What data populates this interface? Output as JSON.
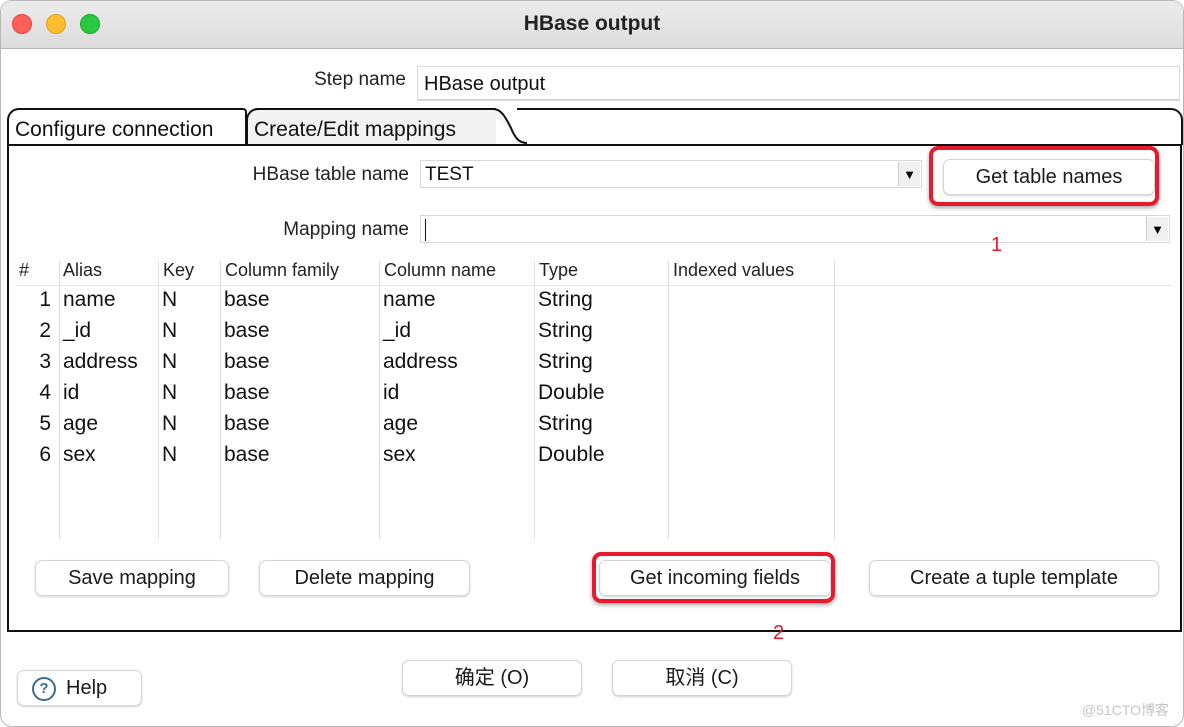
{
  "window": {
    "title": "HBase output"
  },
  "step": {
    "label": "Step name",
    "value": "HBase output"
  },
  "tabs": [
    {
      "label": "Configure connection",
      "active": false
    },
    {
      "label": "Create/Edit mappings",
      "active": true
    }
  ],
  "mapping_tab": {
    "table_name_label": "HBase table name",
    "table_name_value": "TEST",
    "get_table_names_button": "Get table names",
    "mapping_name_label": "Mapping name",
    "mapping_name_value": "",
    "table": {
      "columns": [
        "#",
        "Alias",
        "Key",
        "Column family",
        "Column name",
        "Type",
        "Indexed values"
      ],
      "rows": [
        {
          "num": "1",
          "alias": "name",
          "key": "N",
          "family": "base",
          "column": "name",
          "type": "String",
          "indexed": ""
        },
        {
          "num": "2",
          "alias": "_id",
          "key": "N",
          "family": "base",
          "column": "_id",
          "type": "String",
          "indexed": ""
        },
        {
          "num": "3",
          "alias": "address",
          "key": "N",
          "family": "base",
          "column": "address",
          "type": "String",
          "indexed": ""
        },
        {
          "num": "4",
          "alias": "id",
          "key": "N",
          "family": "base",
          "column": "id",
          "type": "Double",
          "indexed": ""
        },
        {
          "num": "5",
          "alias": "age",
          "key": "N",
          "family": "base",
          "column": "age",
          "type": "String",
          "indexed": ""
        },
        {
          "num": "6",
          "alias": "sex",
          "key": "N",
          "family": "base",
          "column": "sex",
          "type": "Double",
          "indexed": ""
        }
      ]
    },
    "buttons": {
      "save_mapping": "Save mapping",
      "delete_mapping": "Delete mapping",
      "get_incoming_fields": "Get incoming fields",
      "create_tuple_template": "Create a tuple template"
    }
  },
  "annotations": {
    "marker_1": "1",
    "marker_2": "2",
    "color": "#e8192c"
  },
  "footer": {
    "help": "Help",
    "ok": "确定 (O)",
    "cancel": "取消 (C)"
  },
  "watermark": "@51CTO博客"
}
